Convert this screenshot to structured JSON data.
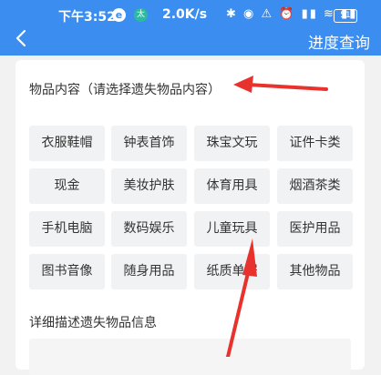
{
  "status_bar": {
    "time": "下午3:52",
    "e_badge": "e",
    "wt_badge": "太",
    "speed": "2.0K/s",
    "icons": "✱ ◉ ⚠ ⏰ ▮▮ ≋ ▮▮",
    "battery": "51"
  },
  "header": {
    "progress_query": "进度查询"
  },
  "items": {
    "title": "物品内容（请选择遗失物品内容）",
    "chips": [
      "衣服鞋帽",
      "钟表首饰",
      "珠宝文玩",
      "证件卡类",
      "现金",
      "美妆护肤",
      "体育用具",
      "烟酒茶类",
      "手机电脑",
      "数码娱乐",
      "儿童玩具",
      "医护用品",
      "图书音像",
      "随身用品",
      "纸质单据",
      "其他物品"
    ]
  },
  "description": {
    "title": "详细描述遗失物品信息"
  },
  "colors": {
    "primary": "#3b8ef0",
    "annotation_arrow": "#e8322e"
  }
}
